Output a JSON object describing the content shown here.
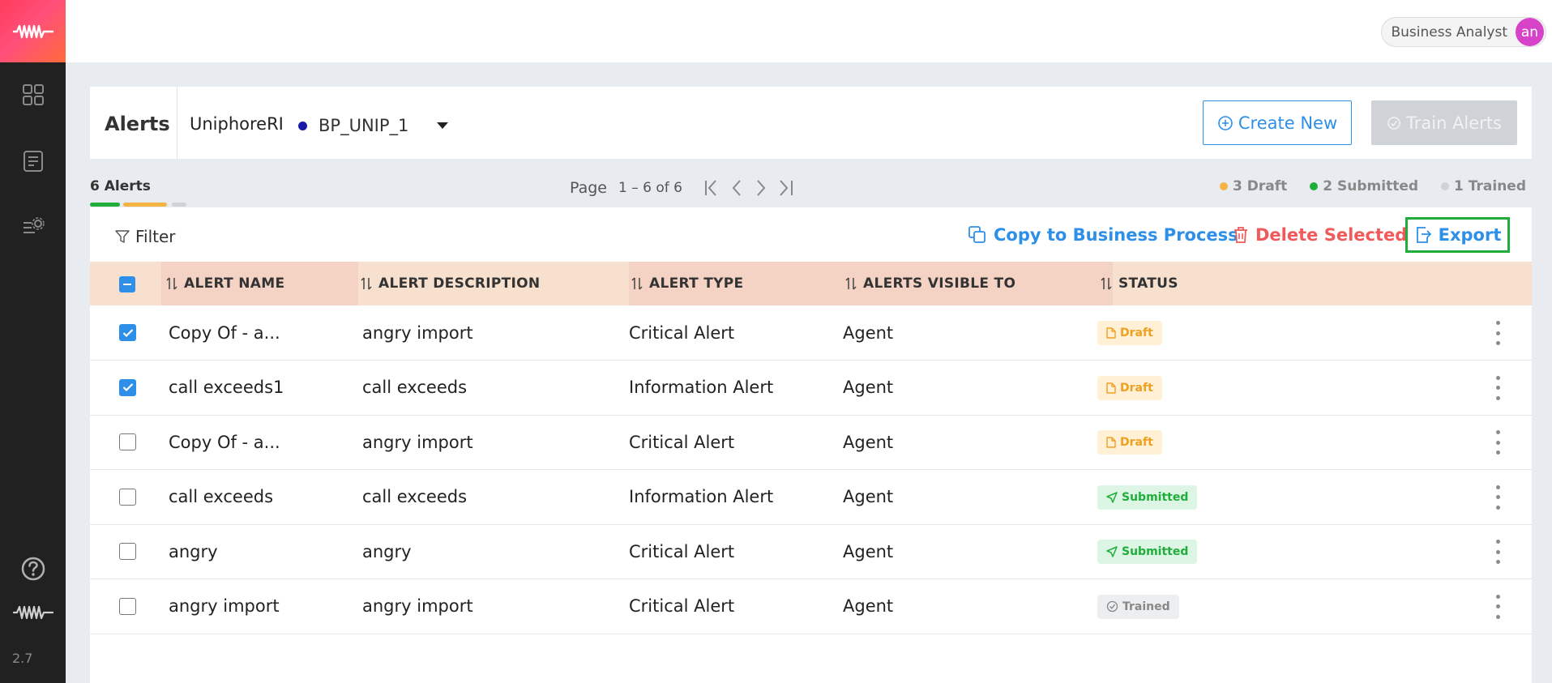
{
  "app": {
    "version": "2.7"
  },
  "sidebar": {
    "icons": [
      "waveform-logo-icon",
      "dashboard-grid-icon",
      "document-list-icon",
      "settings-list-icon",
      "help-icon",
      "waveform-icon"
    ]
  },
  "topbar": {
    "user_role": "Business Analyst",
    "avatar_initials": "an"
  },
  "header": {
    "title": "Alerts",
    "org": "UniphoreRI",
    "business_process": "BP_UNIP_1",
    "create_label": "Create New",
    "train_label": "Train Alerts"
  },
  "summary": {
    "count_label": "6 Alerts",
    "page_label": "Page",
    "page_range": "1 – 6 of 6",
    "draft": "3 Draft",
    "submitted": "2 Submitted",
    "trained": "1 Trained"
  },
  "toolbar": {
    "filter_label": "Filter",
    "copy_label": "Copy to Business Process",
    "delete_label": "Delete Selected",
    "export_label": "Export"
  },
  "table": {
    "columns": [
      "ALERT NAME",
      "ALERT DESCRIPTION",
      "ALERT TYPE",
      "ALERTS VISIBLE TO",
      "STATUS"
    ],
    "rows": [
      {
        "name": "Copy Of - a...",
        "description": "angry import",
        "type": "Critical Alert",
        "visible_to": "Agent",
        "status": "Draft",
        "checked": true
      },
      {
        "name": "call exceeds1",
        "description": "call exceeds",
        "type": "Information Alert",
        "visible_to": "Agent",
        "status": "Draft",
        "checked": true
      },
      {
        "name": "Copy Of - a...",
        "description": "angry import",
        "type": "Critical Alert",
        "visible_to": "Agent",
        "status": "Draft",
        "checked": false
      },
      {
        "name": "call exceeds",
        "description": "call exceeds",
        "type": "Information Alert",
        "visible_to": "Agent",
        "status": "Submitted",
        "checked": false
      },
      {
        "name": "angry",
        "description": "angry",
        "type": "Critical Alert",
        "visible_to": "Agent",
        "status": "Submitted",
        "checked": false
      },
      {
        "name": "angry import",
        "description": "angry import",
        "type": "Critical Alert",
        "visible_to": "Agent",
        "status": "Trained",
        "checked": false
      }
    ]
  },
  "colors": {
    "accent": "#2e8fe8",
    "draft": "#f0a020",
    "submitted": "#1fae3a",
    "trained": "#c8c8c8",
    "delete": "#f05a5a",
    "table_header": "#f8e0cf"
  }
}
